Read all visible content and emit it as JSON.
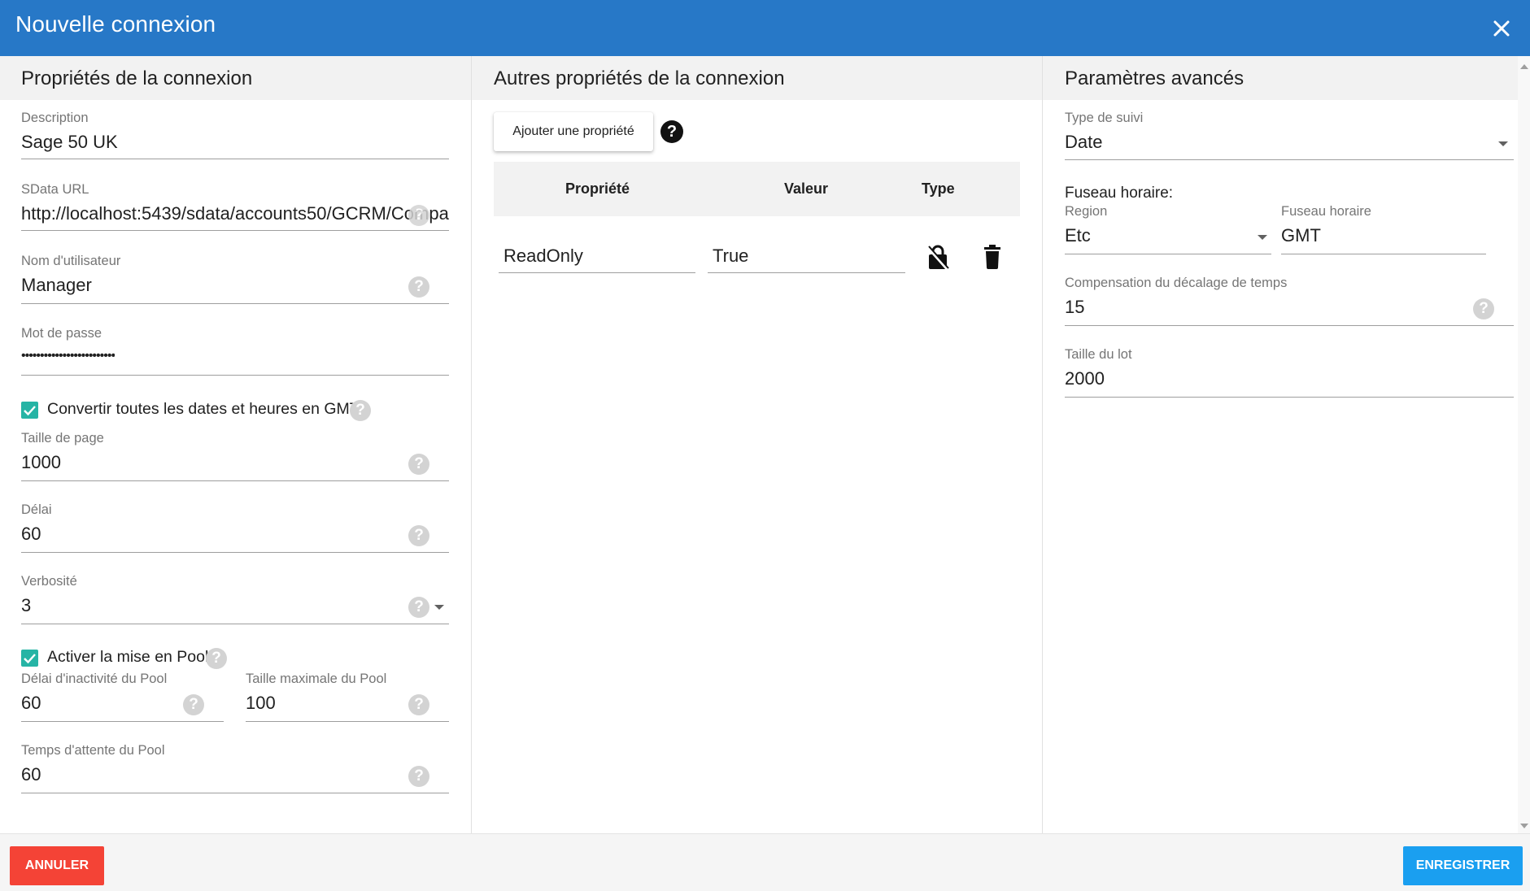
{
  "dialog": {
    "title": "Nouvelle connexion"
  },
  "colors": {
    "header": "#2778c7",
    "checkbox": "#26b4a5",
    "cancel": "#f44336",
    "save": "#1a9ff0"
  },
  "connection": {
    "heading": "Propriétés de la connexion",
    "description": {
      "label": "Description",
      "value": "Sage 50 UK"
    },
    "sdata_url": {
      "label": "SData URL",
      "value": "http://localhost:5439/sdata/accounts50/GCRM/Compa"
    },
    "username": {
      "label": "Nom d'utilisateur",
      "value": "Manager"
    },
    "password": {
      "label": "Mot de passe",
      "value": "•••••••••••••••••••••••••"
    },
    "convert_gmt": {
      "label": "Convertir toutes les dates et heures en GMT",
      "checked": true
    },
    "page_size": {
      "label": "Taille de page",
      "value": "1000"
    },
    "timeout": {
      "label": "Délai",
      "value": "60"
    },
    "verbosity": {
      "label": "Verbosité",
      "value": "3"
    },
    "pooling": {
      "label": "Activer la mise en Pool",
      "checked": true
    },
    "pool_idle": {
      "label": "Délai d'inactivité du Pool",
      "value": "60"
    },
    "pool_max": {
      "label": "Taille maximale du Pool",
      "value": "100"
    },
    "pool_wait": {
      "label": "Temps d'attente du Pool",
      "value": "60"
    }
  },
  "other": {
    "heading": "Autres propriétés de la connexion",
    "add_button": "Ajouter une propriété",
    "columns": {
      "property": "Propriété",
      "value": "Valeur",
      "type": "Type"
    },
    "rows": [
      {
        "property": "ReadOnly",
        "value": "True"
      }
    ]
  },
  "advanced": {
    "heading": "Paramètres avancés",
    "tracking_type": {
      "label": "Type de suivi",
      "value": "Date"
    },
    "timezone_heading": "Fuseau horaire:",
    "region": {
      "label": "Region",
      "value": "Etc"
    },
    "timezone": {
      "label": "Fuseau horaire",
      "value": "GMT"
    },
    "time_offset": {
      "label": "Compensation du décalage de temps",
      "value": "15"
    },
    "batch_size": {
      "label": "Taille du lot",
      "value": "2000"
    }
  },
  "footer": {
    "cancel": "ANNULER",
    "save": "ENREGISTRER"
  },
  "icons": {
    "help": "?",
    "close": "close-icon",
    "lock": "lock-icon",
    "delete": "trash-icon"
  }
}
